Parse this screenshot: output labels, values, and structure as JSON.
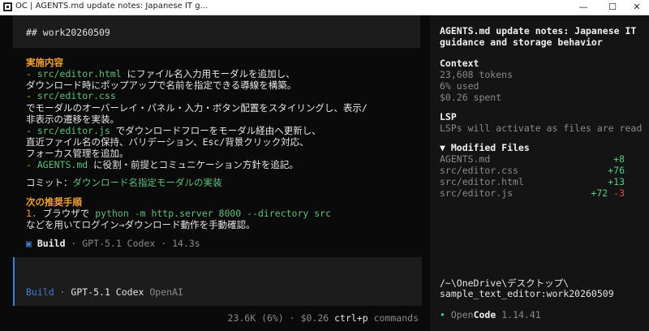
{
  "window": {
    "title": "OC | AGENTS.md update notes: Japanese IT g...",
    "minimize": "—",
    "maximize": "☐",
    "close": "✕"
  },
  "conversation": {
    "user_message": "## work20260509",
    "section_done_heading": "実施内容",
    "items": [
      {
        "bullet": "- ",
        "path": "src/editor.html",
        "text": " にファイル名入力用モーダルを追加し、",
        "cont": "ダウンロード時にポップアップで名前を指定できる導線を構築。"
      },
      {
        "bullet": "- ",
        "path": "src/editor.css",
        "text": "",
        "cont": "でモーダルのオーバーレイ・パネル・入力・ボタン配置をスタイリングし、表示/",
        "cont2": "非表示の遷移を実装。"
      },
      {
        "bullet": "- ",
        "path": "src/editor.js",
        "text": " でダウンロードフローをモーダル経由へ更新し、",
        "cont": "直近ファイル名の保持、バリデーション、Esc/背景クリック対応、",
        "cont2": "フォーカス管理を追加。"
      },
      {
        "bullet": "- ",
        "path": "AGENTS.md",
        "text": " に役割・前提とコミュニケーション方針を追記。"
      }
    ],
    "commit_label": "コミット：",
    "commit_value": "ダウンロード名指定モーダルの実装",
    "next_heading": "次の推奨手順",
    "next_number": "1. ",
    "next_text_a": "ブラウザで ",
    "next_code": "python -m http.server 8000 --directory src",
    "next_text_b": "などを用いてログイン→ダウンロード動作を手動確認。",
    "build_marker": "▣",
    "build_label": "Build",
    "build_sep1": " · ",
    "build_model": "GPT-5.1 Codex",
    "build_sep2": " · ",
    "build_time": "14.3s"
  },
  "prompt": {
    "mode": "Build",
    "sep": " · ",
    "model": "GPT-5.1 Codex",
    "provider": "OpenAI"
  },
  "footer": {
    "tokens": "23.6K (6%)",
    "sep": " · ",
    "cost": "$0.26",
    "shortcut": "ctrl+p",
    "shortcut_label": "commands"
  },
  "sidebar": {
    "title_line1": "AGENTS.md update notes: Japanese IT",
    "title_line2": "guidance and storage behavior",
    "context_heading": "Context",
    "context_tokens": "23,608 tokens",
    "context_used": "6% used",
    "context_spent": "$0.26 spent",
    "lsp_heading": "LSP",
    "lsp_text": "LSPs will activate as files are read",
    "modified_heading": "▼ Modified Files",
    "files": [
      {
        "name": "AGENTS.md",
        "add": "+8",
        "del": ""
      },
      {
        "name": "src/editor.css",
        "add": "+76",
        "del": ""
      },
      {
        "name": "src/editor.html",
        "add": "+13",
        "del": ""
      },
      {
        "name": "src/editor.js",
        "add": "+72",
        "del": "-3"
      }
    ],
    "cwd_line1": "/~\\OneDrive\\デスクトップ\\",
    "cwd_line2": "sample_text_editor:work20260509",
    "brand_dot": "•",
    "brand_open": "Open",
    "brand_code": "Code",
    "version": "1.14.41"
  },
  "colors": {
    "accent_orange": "#f0a030",
    "path_green": "#5fc07a",
    "prompt_border": "#3d7fd0",
    "added": "#4fd08a",
    "removed": "#e05050"
  }
}
